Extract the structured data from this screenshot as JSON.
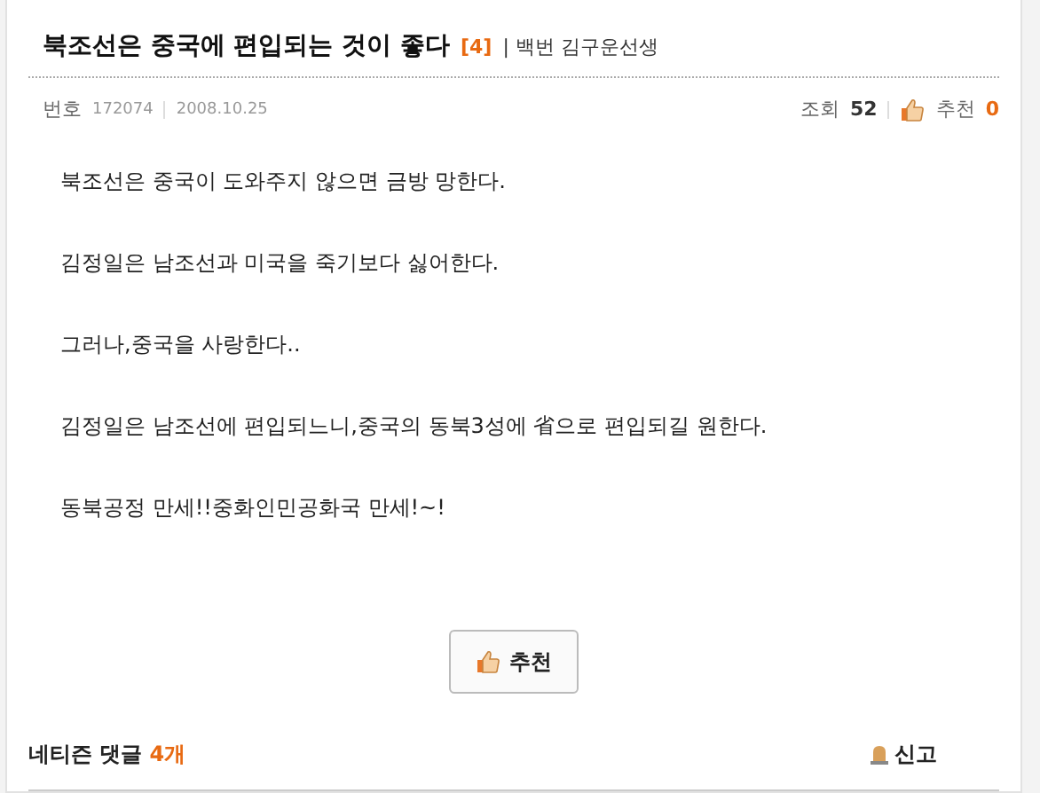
{
  "post": {
    "title": "북조선은 중국에 편입되는 것이 좋다",
    "comment_count": "[4]",
    "author": "| 백번 김구운선생",
    "meta": {
      "number_label": "번호",
      "number": "172074",
      "date": "2008.10.25",
      "views_label": "조회",
      "views": "52",
      "recommend_label": "추천",
      "recommends": "0"
    },
    "paragraphs": [
      "북조선은 중국이 도와주지 않으면 금방 망한다.",
      "김정일은 남조선과 미국을 죽기보다 싫어한다.",
      "그러나,중국을 사랑한다..",
      "김정일은 남조선에 편입되느니,중국의 동북3성에 省으로 편입되길 원한다.",
      "동북공정 만세!!중화인민공화국 만세!~!"
    ],
    "recommend_button": "추천"
  },
  "comments": {
    "label": "네티즌 댓글",
    "count": "4개",
    "report": "신고"
  }
}
